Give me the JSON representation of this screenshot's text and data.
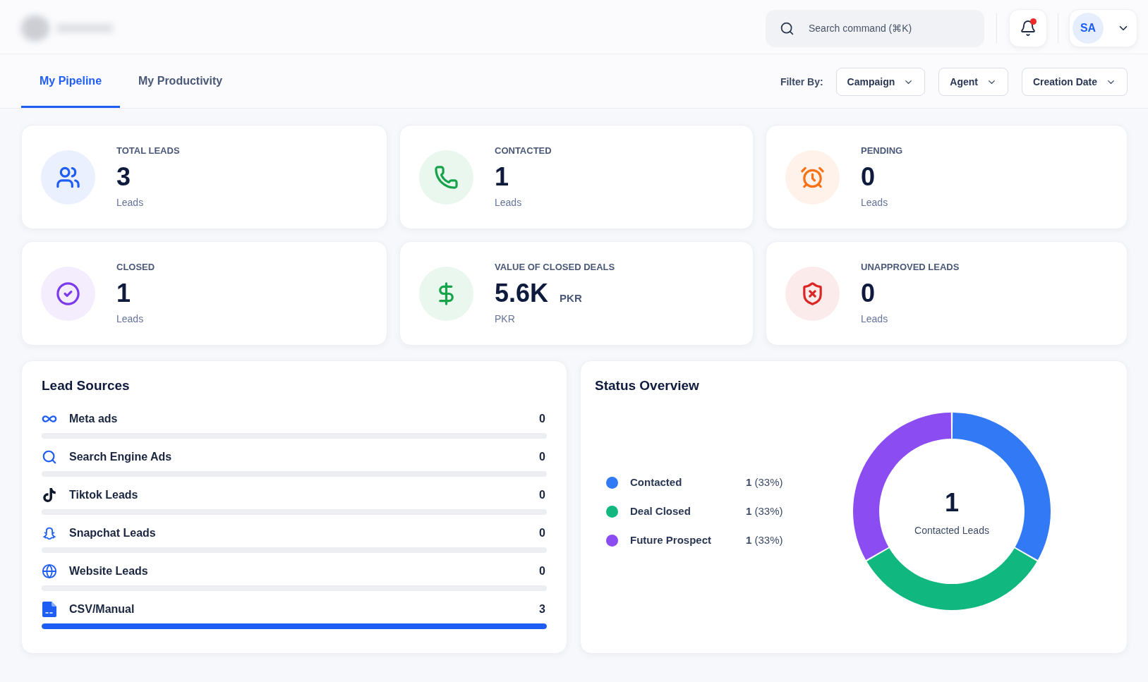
{
  "header": {
    "search": {
      "placeholder": "Search command (⌘K)"
    },
    "notifications": {
      "unread_dot": true
    },
    "user": {
      "initials": "SA"
    }
  },
  "tabs": [
    {
      "label": "My Pipeline",
      "selected": true
    },
    {
      "label": "My Productivity",
      "selected": false
    }
  ],
  "filters": {
    "label": "Filter By:",
    "dropdowns": [
      "Campaign",
      "Agent",
      "Creation Date"
    ]
  },
  "stats": [
    {
      "label": "TOTAL LEADS",
      "value": "3",
      "caption": "Leads",
      "color": "#1f5ef5"
    },
    {
      "label": "CONTACTED",
      "value": "1",
      "caption": "Leads",
      "color": "#16a34a"
    },
    {
      "label": "PENDING",
      "value": "0",
      "caption": "Leads",
      "color": "#f97316"
    },
    {
      "label": "CLOSED",
      "value": "1",
      "caption": "Leads",
      "color": "#7c3aed"
    },
    {
      "label": "VALUE OF CLOSED DEALS",
      "value": "5.6K",
      "unit": "PKR",
      "caption": "PKR",
      "color": "#16a34a"
    },
    {
      "label": "UNAPPROVED LEADS",
      "value": "0",
      "caption": "Leads",
      "color": "#dc2626"
    }
  ],
  "lead_sources": {
    "title": "Lead Sources",
    "items": [
      {
        "name": "Meta ads",
        "count": "0",
        "level": 0
      },
      {
        "name": "Search Engine Ads",
        "count": "0",
        "level": 0
      },
      {
        "name": "Tiktok Leads",
        "count": "0",
        "level": 0
      },
      {
        "name": "Snapchat Leads",
        "count": "0",
        "level": 0
      },
      {
        "name": "Website Leads",
        "count": "0",
        "level": 0
      },
      {
        "name": "CSV/Manual",
        "count": "3",
        "level": 1
      }
    ]
  },
  "status_overview": {
    "title": "Status Overview",
    "legend": [
      {
        "value": "**1** (33%)",
        "color": "#3279f5"
      },
      {
        "value": "**1** (33%)",
        "color": "#10b77f"
      },
      {
        "value": "**1** (33%)",
        "color": "#8b4cf2"
      }
    ],
    "center": {
      "value": "1",
      "caption": "Contacted Leads"
    },
    "chart_data": {
      "type": "donut",
      "categories": [
        "Contacted",
        "Deal Closed",
        "Future Prospect"
      ],
      "values": [
        33.33,
        33.33,
        33.34
      ]
    }
  }
}
